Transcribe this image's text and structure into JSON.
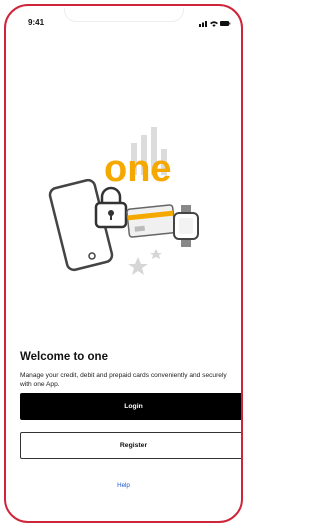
{
  "status_bar": {
    "time": "9:41"
  },
  "brand": {
    "logo_text": "one",
    "logo_color": "#f5a800",
    "frame_color": "#d0243a"
  },
  "welcome": {
    "title": "Welcome to one",
    "description": "Manage your credit, debit and prepaid cards conveniently and securely with one App."
  },
  "actions": {
    "login_label": "Login",
    "register_label": "Register",
    "help_label": "Help"
  }
}
